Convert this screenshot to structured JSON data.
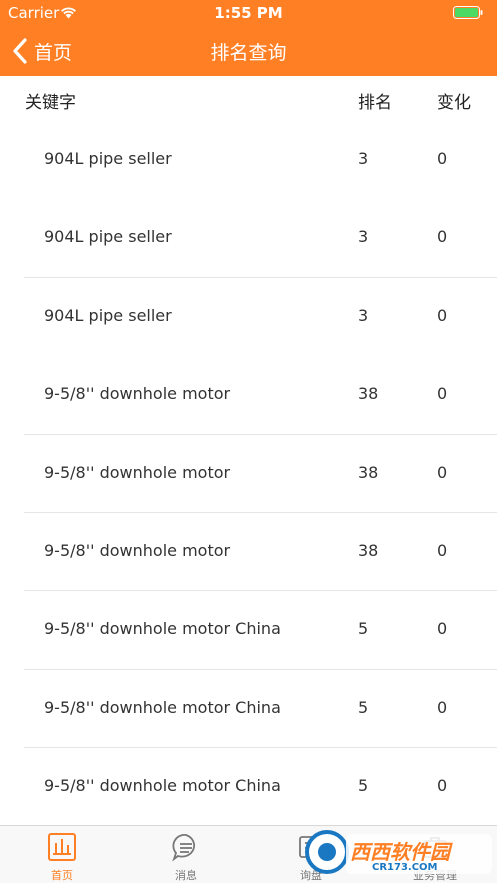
{
  "status": {
    "carrier": "Carrier",
    "time": "1:55 PM"
  },
  "nav": {
    "back_label": "首页",
    "title": "排名查询"
  },
  "table": {
    "headers": {
      "keyword": "关键字",
      "rank": "排名",
      "change": "变化"
    },
    "rows": [
      {
        "keyword": "904L pipe seller",
        "rank": "3",
        "change": "0"
      },
      {
        "keyword": "904L pipe seller",
        "rank": "3",
        "change": "0"
      },
      {
        "keyword": "904L pipe seller",
        "rank": "3",
        "change": "0"
      },
      {
        "keyword": "9-5/8'' downhole motor",
        "rank": "38",
        "change": "0"
      },
      {
        "keyword": "9-5/8'' downhole motor",
        "rank": "38",
        "change": "0"
      },
      {
        "keyword": "9-5/8'' downhole motor",
        "rank": "38",
        "change": "0"
      },
      {
        "keyword": "9-5/8'' downhole motor China",
        "rank": "5",
        "change": "0"
      },
      {
        "keyword": "9-5/8'' downhole motor China",
        "rank": "5",
        "change": "0"
      },
      {
        "keyword": "9-5/8'' downhole motor China",
        "rank": "5",
        "change": "0"
      }
    ]
  },
  "tabbar": {
    "items": [
      {
        "label": "首页",
        "icon": "chart-icon",
        "active": true
      },
      {
        "label": "消息",
        "icon": "message-icon",
        "active": false
      },
      {
        "label": "询盘",
        "icon": "inquiry-icon",
        "active": false
      },
      {
        "label": "业务管理",
        "icon": "business-icon",
        "active": false
      }
    ]
  },
  "watermark": {
    "text": "西西软件园",
    "sub": "CR173.COM"
  },
  "colors": {
    "accent": "#ff7f24"
  }
}
